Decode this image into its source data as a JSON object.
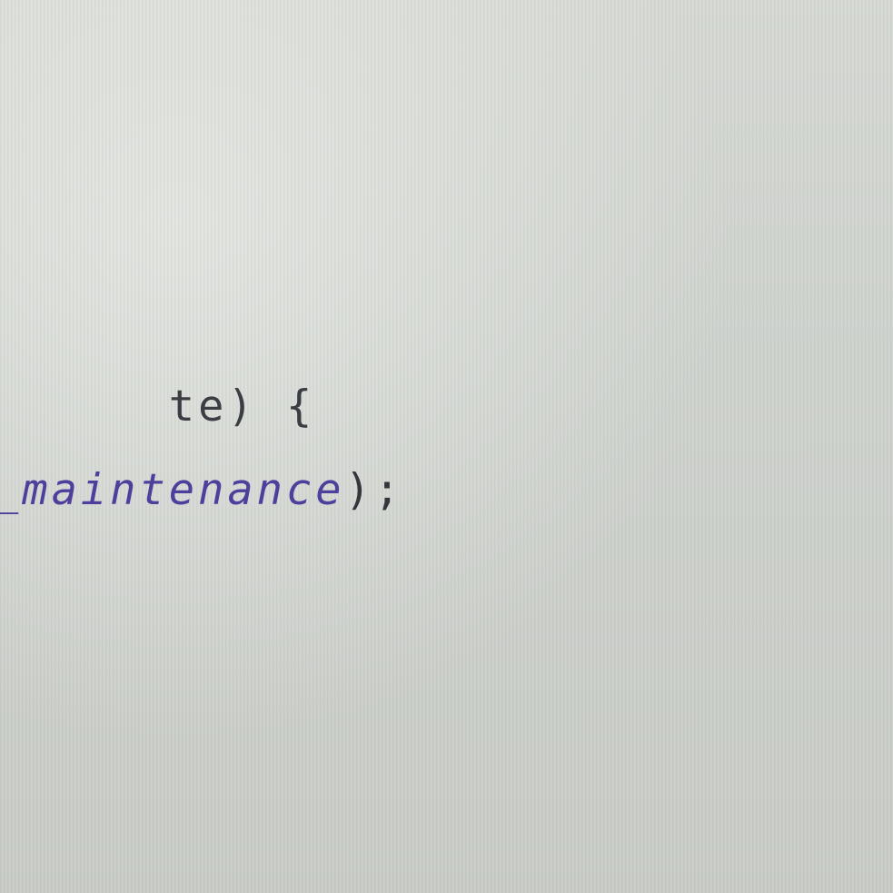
{
  "editor": {
    "lines": [
      {
        "text": "te) {"
      },
      {
        "prefix": "_",
        "identifier": "maintenance",
        "suffix": ");"
      }
    ],
    "colors": {
      "background": "#cfd2cd",
      "text": "#3b3d42",
      "identifier": "#4e3f9c"
    }
  }
}
